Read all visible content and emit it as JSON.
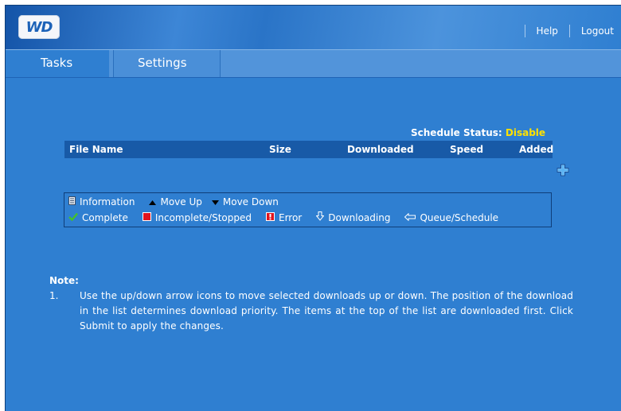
{
  "header": {
    "logo_text": "WD",
    "links": {
      "help": "Help",
      "logout": "Logout"
    }
  },
  "tabs": [
    {
      "label": "Tasks",
      "active": true
    },
    {
      "label": "Settings",
      "active": false
    }
  ],
  "schedule": {
    "label": "Schedule Status:",
    "value": "Disable",
    "value_color": "#ffe200"
  },
  "table": {
    "columns": [
      "File Name",
      "Size",
      "Downloaded",
      "Speed",
      "Added"
    ],
    "rows": []
  },
  "legend": {
    "row1": [
      {
        "icon": "information-icon",
        "label": "Information"
      },
      {
        "icon": "move-up-icon",
        "label": "Move Up"
      },
      {
        "icon": "move-down-icon",
        "label": "Move Down"
      }
    ],
    "row2": [
      {
        "icon": "complete-check-icon",
        "label": "Complete"
      },
      {
        "icon": "incomplete-stopped-icon",
        "label": "Incomplete/Stopped"
      },
      {
        "icon": "error-icon",
        "label": "Error"
      },
      {
        "icon": "downloading-icon",
        "label": "Downloading"
      },
      {
        "icon": "queue-schedule-icon",
        "label": "Queue/Schedule"
      }
    ]
  },
  "note": {
    "title": "Note:",
    "items": [
      {
        "num": "1.",
        "text": "Use the up/down arrow icons to move selected downloads up or down. The position of the download in the list determines download priority. The items at the top of the list are downloaded first. Click Submit to apply the changes."
      }
    ]
  },
  "colors": {
    "background": "#2f7fd1",
    "header_dark": "#1454a8",
    "table_header": "#185aa7",
    "accent_yellow": "#ffe200",
    "error_red": "#e0141e",
    "complete_green": "#44c12a"
  }
}
